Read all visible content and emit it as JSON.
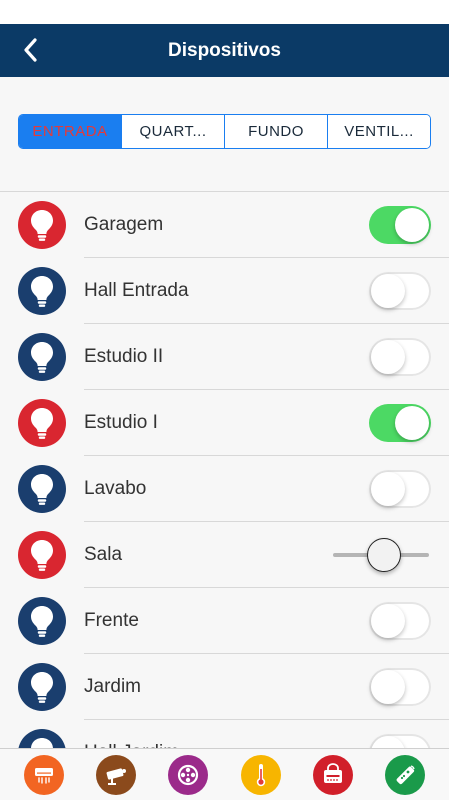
{
  "header": {
    "title": "Dispositivos"
  },
  "segments": [
    {
      "label": "ENTRADA",
      "active": true
    },
    {
      "label": "QUART...",
      "active": false
    },
    {
      "label": "FUNDO",
      "active": false
    },
    {
      "label": "VENTIL...",
      "active": false
    }
  ],
  "devices": [
    {
      "label": "Garagem",
      "state": "on",
      "control": "toggle"
    },
    {
      "label": "Hall Entrada",
      "state": "off",
      "control": "toggle"
    },
    {
      "label": "Estudio II",
      "state": "off",
      "control": "toggle"
    },
    {
      "label": "Estudio I",
      "state": "on",
      "control": "toggle"
    },
    {
      "label": "Lavabo",
      "state": "off",
      "control": "toggle"
    },
    {
      "label": "Sala",
      "state": "on",
      "control": "slider",
      "level": 0.55
    },
    {
      "label": "Frente",
      "state": "off",
      "control": "toggle"
    },
    {
      "label": "Jardim",
      "state": "off",
      "control": "toggle"
    },
    {
      "label": "Hall Jardim",
      "state": "off",
      "control": "toggle"
    }
  ],
  "tabbar": [
    {
      "icon": "air-conditioner-icon",
      "color": "#f26522"
    },
    {
      "icon": "camera-icon",
      "color": "#8b4a1c"
    },
    {
      "icon": "film-reel-icon",
      "color": "#9b2a8a"
    },
    {
      "icon": "thermometer-icon",
      "color": "#f7b500"
    },
    {
      "icon": "alarm-panel-icon",
      "color": "#d11f2a"
    },
    {
      "icon": "remote-control-icon",
      "color": "#1a9a4a"
    }
  ],
  "colors": {
    "navbar": "#0b3a66",
    "accent": "#1a7ef0",
    "bulb_on": "#d92630",
    "bulb_off": "#1a3e6e",
    "toggle_on": "#4cd964"
  }
}
